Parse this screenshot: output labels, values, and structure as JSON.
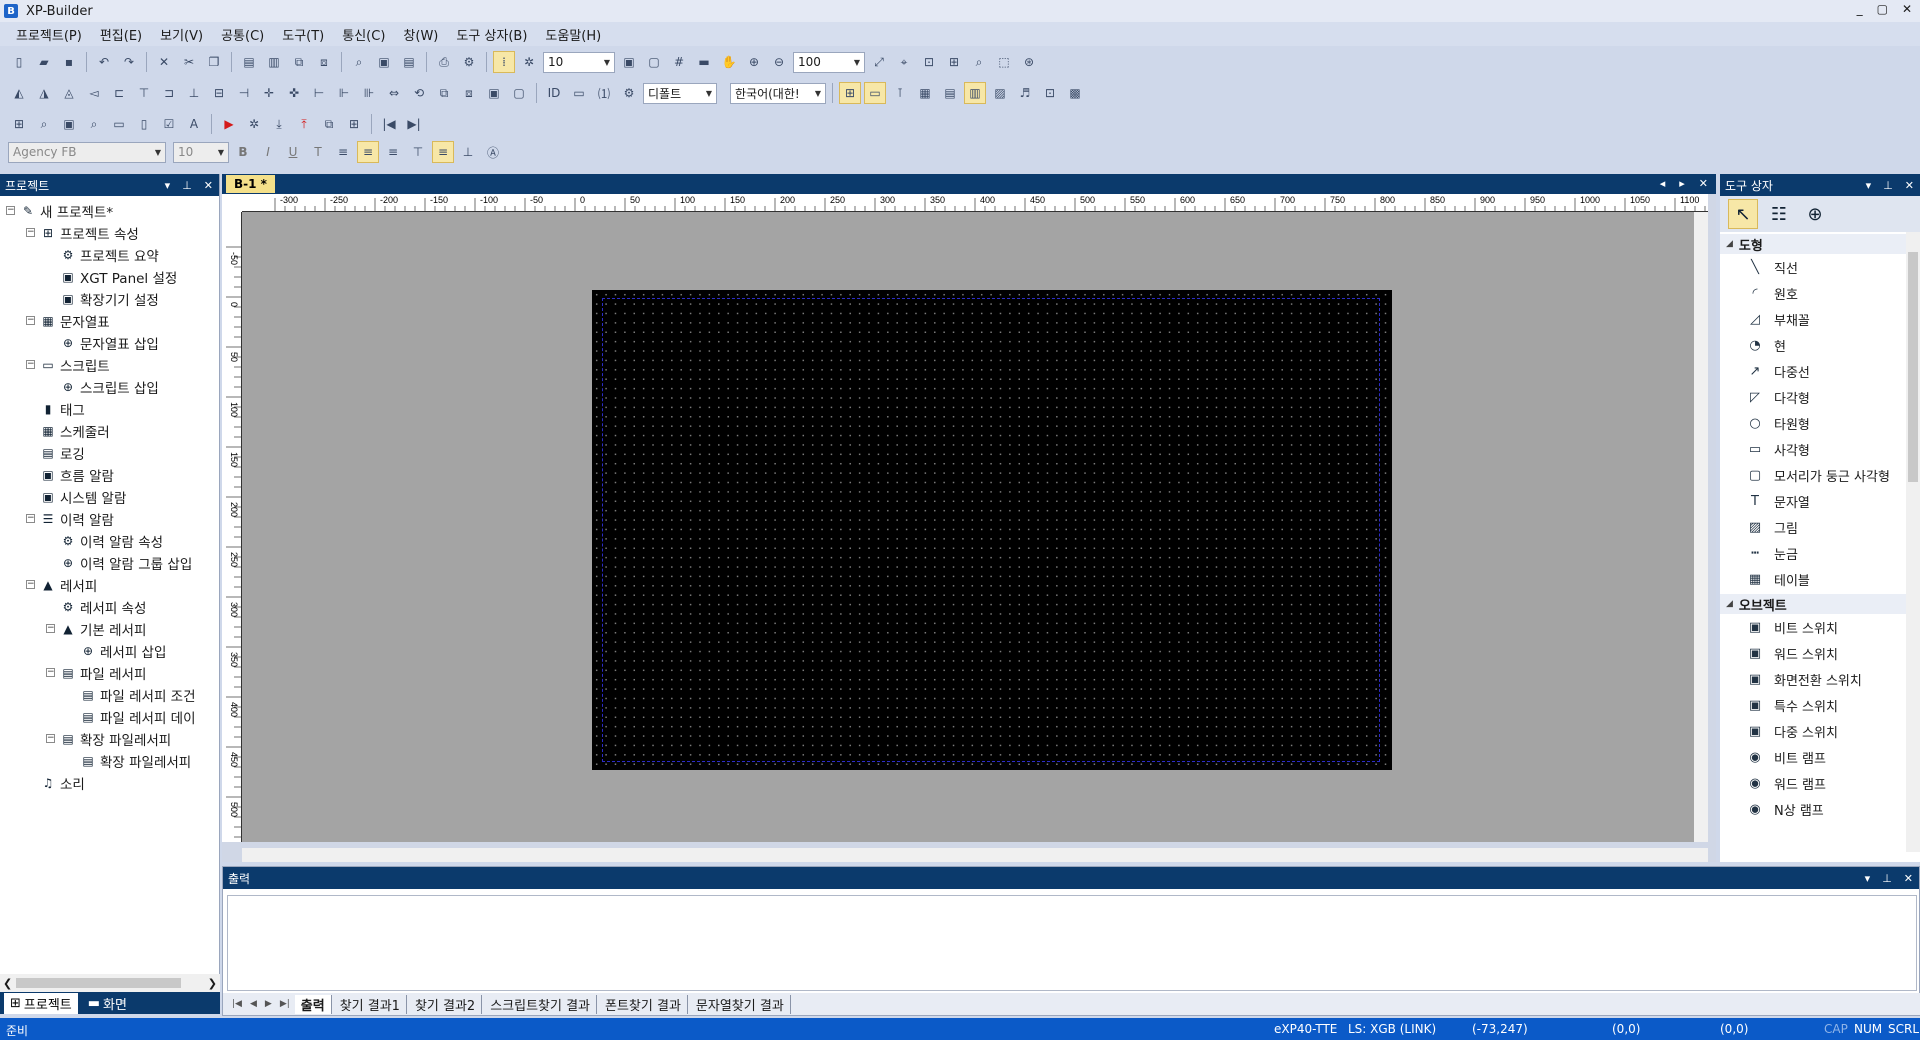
{
  "app": {
    "title": "XP-Builder",
    "logo": "B"
  },
  "window_controls": [
    "_",
    "▢",
    "✕"
  ],
  "menu": [
    "프로젝트(P)",
    "편집(E)",
    "보기(V)",
    "공통(C)",
    "도구(T)",
    "통신(C)",
    "창(W)",
    "도구 상자(B)",
    "도움말(H)"
  ],
  "toolbar": {
    "grid_combo": "10",
    "zoom_combo": "100",
    "default_combo": "디폴트",
    "language_combo": "한국어(대한!",
    "font_combo": "Agency FB",
    "font_size_combo": "10"
  },
  "project_panel": {
    "title": "프로젝트",
    "tree": [
      {
        "label": "새 프로젝트*",
        "icon": "✎",
        "level": 0,
        "exp": "-"
      },
      {
        "label": "프로젝트 속성",
        "icon": "⊞",
        "level": 1,
        "exp": "-"
      },
      {
        "label": "프로젝트 요약",
        "icon": "⚙",
        "level": 2
      },
      {
        "label": "XGT Panel 설정",
        "icon": "▣",
        "level": 2
      },
      {
        "label": "확장기기 설정",
        "icon": "▣",
        "level": 2
      },
      {
        "label": "문자열표",
        "icon": "▦",
        "level": 1,
        "exp": "-"
      },
      {
        "label": "문자열표 삽입",
        "icon": "⊕",
        "level": 2
      },
      {
        "label": "스크립트",
        "icon": "▭",
        "level": 1,
        "exp": "-"
      },
      {
        "label": "스크립트 삽입",
        "icon": "⊕",
        "level": 2
      },
      {
        "label": "태그",
        "icon": "▮",
        "level": 1
      },
      {
        "label": "스케줄러",
        "icon": "▦",
        "level": 1
      },
      {
        "label": "로깅",
        "icon": "▤",
        "level": 1
      },
      {
        "label": "흐름 알람",
        "icon": "▣",
        "level": 1
      },
      {
        "label": "시스템 알람",
        "icon": "▣",
        "level": 1
      },
      {
        "label": "이력 알람",
        "icon": "☰",
        "level": 1,
        "exp": "-"
      },
      {
        "label": "이력 알람 속성",
        "icon": "⚙",
        "level": 2
      },
      {
        "label": "이력 알람 그룹 삽입",
        "icon": "⊕",
        "level": 2
      },
      {
        "label": "레서피",
        "icon": "▲",
        "level": 1,
        "exp": "-"
      },
      {
        "label": "레서피 속성",
        "icon": "⚙",
        "level": 2
      },
      {
        "label": "기본 레서피",
        "icon": "▲",
        "level": 2,
        "exp": "-"
      },
      {
        "label": "레서피 삽입",
        "icon": "⊕",
        "level": 3
      },
      {
        "label": "파일 레서피",
        "icon": "▤",
        "level": 2,
        "exp": "-"
      },
      {
        "label": "파일 레서피 조건",
        "icon": "▤",
        "level": 3
      },
      {
        "label": "파일 레서피 데이",
        "icon": "▤",
        "level": 3
      },
      {
        "label": "확장 파일레서피",
        "icon": "▤",
        "level": 2,
        "exp": "-"
      },
      {
        "label": "확장 파일레서피",
        "icon": "▤",
        "level": 3
      },
      {
        "label": "소리",
        "icon": "♫",
        "level": 1
      }
    ],
    "tabs": [
      "프로젝트",
      "화면"
    ]
  },
  "document": {
    "tab_label": "B-1 *",
    "hruler_labels": [
      "-300",
      "-250",
      "-200",
      "-150",
      "-100",
      "-50",
      "0",
      "50",
      "100",
      "150",
      "200",
      "250",
      "300",
      "350",
      "400",
      "450",
      "500",
      "550",
      "600",
      "650",
      "700",
      "750",
      "800",
      "850",
      "900",
      "950",
      "1000",
      "1050",
      "1100"
    ],
    "vruler_labels": [
      "-50",
      "0",
      "50",
      "100",
      "150",
      "200",
      "250",
      "300",
      "350",
      "400",
      "450",
      "500",
      "550"
    ]
  },
  "toolbox": {
    "title": "도구 상자",
    "groups": [
      {
        "name": "도형",
        "items": [
          {
            "label": "직선",
            "icon": "╲"
          },
          {
            "label": "원호",
            "icon": "◜"
          },
          {
            "label": "부채꼴",
            "icon": "◿"
          },
          {
            "label": "현",
            "icon": "◔"
          },
          {
            "label": "다중선",
            "icon": "↗"
          },
          {
            "label": "다각형",
            "icon": "◸"
          },
          {
            "label": "타원형",
            "icon": "○"
          },
          {
            "label": "사각형",
            "icon": "▭"
          },
          {
            "label": "모서리가 둥근 사각형",
            "icon": "▢"
          },
          {
            "label": "문자열",
            "icon": "T"
          },
          {
            "label": "그림",
            "icon": "▨"
          },
          {
            "label": "눈금",
            "icon": "┅"
          },
          {
            "label": "테이블",
            "icon": "▦"
          }
        ]
      },
      {
        "name": "오브젝트",
        "items": [
          {
            "label": "비트 스위치",
            "icon": "▣"
          },
          {
            "label": "워드 스위치",
            "icon": "▣"
          },
          {
            "label": "화면전환 스위치",
            "icon": "▣"
          },
          {
            "label": "특수 스위치",
            "icon": "▣"
          },
          {
            "label": "다중 스위치",
            "icon": "▣"
          },
          {
            "label": "비트 램프",
            "icon": "◉"
          },
          {
            "label": "워드 램프",
            "icon": "◉"
          },
          {
            "label": "N상 램프",
            "icon": "◉"
          }
        ]
      }
    ]
  },
  "output": {
    "title": "출력",
    "tabs": [
      "출력",
      "찾기 결과1",
      "찾기 결과2",
      "스크립트찾기 결과",
      "폰트찾기 결과",
      "문자열찾기 결과"
    ]
  },
  "status": {
    "ready": "준비",
    "device": "eXP40-TTE",
    "link": "LS: XGB (LINK)",
    "coords": "(-73,247)",
    "pos1": "(0,0)",
    "pos2": "(0,0)",
    "cap": "CAP",
    "num": "NUM",
    "scrl": "SCRL"
  }
}
